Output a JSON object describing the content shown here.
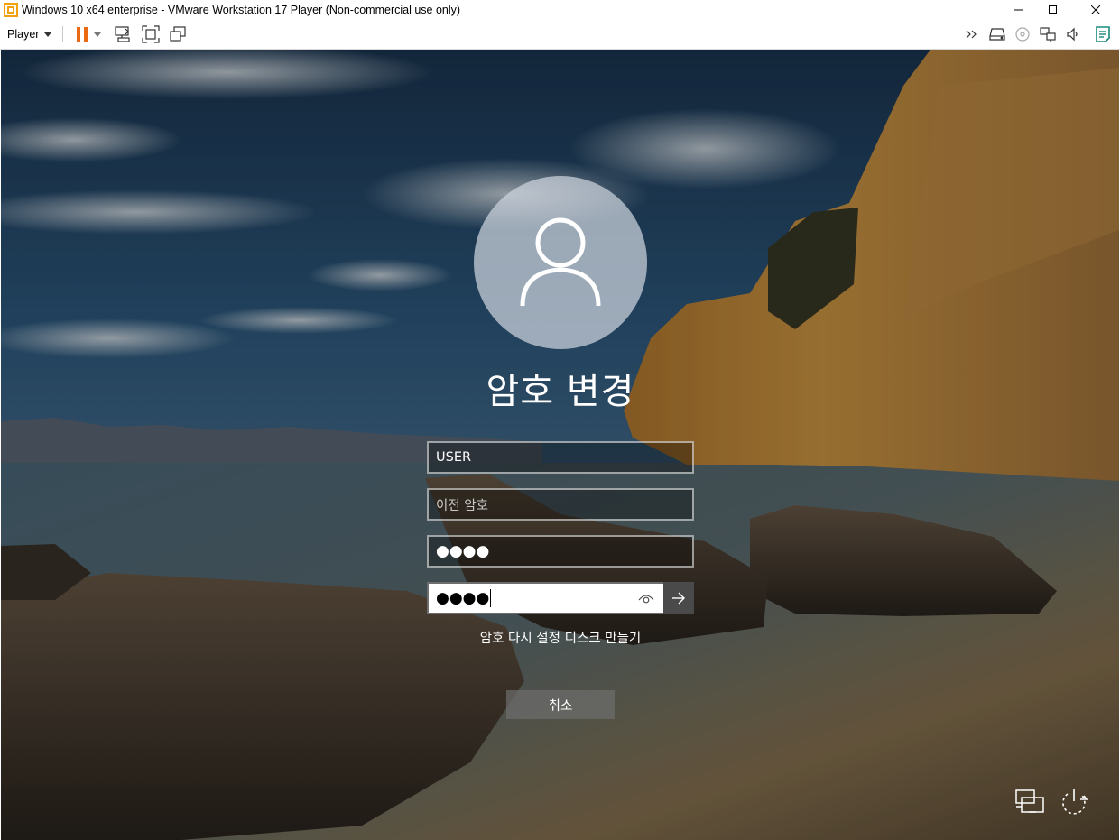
{
  "window": {
    "title": "Windows 10 x64 enterprise - VMware Workstation 17 Player (Non-commercial use only)",
    "controls": [
      "minimize-icon",
      "maximize-icon",
      "close-icon"
    ]
  },
  "toolbar": {
    "player_label": "Player",
    "left_icons": [
      "pause-icon",
      "send-ctrl-alt-del-icon",
      "fullscreen-icon",
      "unity-icon"
    ],
    "right_icons": [
      "more-devices-icon",
      "hard-disk-icon",
      "cd-drive-icon",
      "network-adapter-icon",
      "sound-card-icon",
      "message-log-icon"
    ],
    "accent_color": "#e96a13"
  },
  "login": {
    "heading": "암호 변경",
    "username_value": "USER",
    "old_password_placeholder": "이전 암호",
    "new_password_value": "●●●●",
    "confirm_password_value": "●●●●",
    "reset_disk_link": "암호 다시 설정 디스크 만들기",
    "cancel_label": "취소",
    "bottom_icons": [
      "network-icon",
      "power-icon"
    ]
  }
}
